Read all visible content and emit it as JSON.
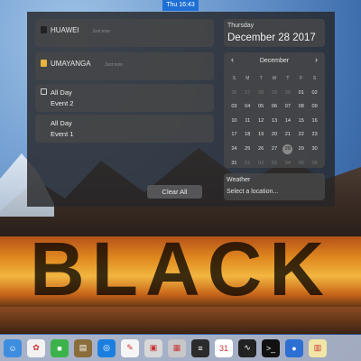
{
  "menubar": {
    "clock": "Thu 16:43"
  },
  "notifications": [
    {
      "title": "HUAWEI",
      "time": "Just now"
    },
    {
      "title": "UMAYANGA",
      "time": "Just now"
    }
  ],
  "events": [
    {
      "line1": "All Day",
      "line2": "Event 2"
    },
    {
      "line1": "All Day",
      "line2": "Event 1"
    }
  ],
  "clear_button": "Clear All",
  "date": {
    "weekday": "Thursday",
    "full": "December 28 2017"
  },
  "calendar": {
    "month": "December",
    "prev_icon": "‹",
    "next_icon": "›",
    "weekdays": [
      "S",
      "M",
      "T",
      "W",
      "T",
      "F",
      "S"
    ],
    "weeks": [
      [
        "26",
        "27",
        "28",
        "29",
        "30",
        "01",
        "02"
      ],
      [
        "03",
        "04",
        "05",
        "06",
        "07",
        "08",
        "09"
      ],
      [
        "10",
        "11",
        "12",
        "13",
        "14",
        "15",
        "16"
      ],
      [
        "17",
        "18",
        "19",
        "20",
        "21",
        "22",
        "23"
      ],
      [
        "24",
        "25",
        "26",
        "27",
        "28",
        "29",
        "30"
      ],
      [
        "31",
        "01",
        "02",
        "03",
        "04",
        "05",
        "06"
      ]
    ],
    "muted": [
      [
        0,
        0
      ],
      [
        0,
        1
      ],
      [
        0,
        2
      ],
      [
        0,
        3
      ],
      [
        0,
        4
      ],
      [
        5,
        1
      ],
      [
        5,
        2
      ],
      [
        5,
        3
      ],
      [
        5,
        4
      ],
      [
        5,
        5
      ],
      [
        5,
        6
      ]
    ],
    "today": [
      4,
      4
    ]
  },
  "weather": {
    "title": "Weather",
    "subtitle": "Select a location..."
  },
  "overlay_text": "BLACK",
  "dock": {
    "items": [
      {
        "name": "finder-icon",
        "bg": "#3d8de0",
        "glyph": "☺"
      },
      {
        "name": "photos-icon",
        "bg": "#f2f2f2",
        "glyph": "✿"
      },
      {
        "name": "facetime-icon",
        "bg": "#3bb34a",
        "glyph": "■"
      },
      {
        "name": "preview-icon",
        "bg": "#8a6d3b",
        "glyph": "▤"
      },
      {
        "name": "safari-icon",
        "bg": "#1c7fe0",
        "glyph": "◎"
      },
      {
        "name": "textedit-icon",
        "bg": "#f5f5f5",
        "glyph": "✎"
      },
      {
        "name": "photo-booth-icon",
        "bg": "#d8d8d8",
        "glyph": "▣"
      },
      {
        "name": "image-capture-icon",
        "bg": "#c7c7c7",
        "glyph": "▦"
      },
      {
        "name": "market-icon",
        "bg": "#2b2b2b",
        "glyph": "≡"
      },
      {
        "name": "calendar-icon",
        "bg": "#ffffff",
        "glyph": "31"
      },
      {
        "name": "activity-monitor-icon",
        "bg": "#222",
        "glyph": "∿"
      },
      {
        "name": "terminal-icon",
        "bg": "#111",
        "glyph": ">_"
      },
      {
        "name": "browser-icon",
        "bg": "#2d6fd3",
        "glyph": "●"
      },
      {
        "name": "notes-icon",
        "bg": "#f1e6a6",
        "glyph": "▥"
      }
    ]
  }
}
